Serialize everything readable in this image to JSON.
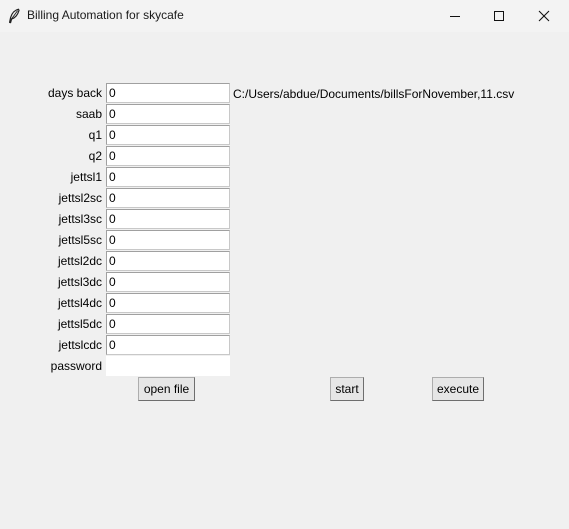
{
  "window": {
    "title": "Billing Automation for skycafe",
    "icon": "feather-icon"
  },
  "form": {
    "rows": [
      {
        "key": "days_back",
        "label": "days back",
        "value": "0"
      },
      {
        "key": "saab",
        "label": "saab",
        "value": "0"
      },
      {
        "key": "q1",
        "label": "q1",
        "value": "0"
      },
      {
        "key": "q2",
        "label": "q2",
        "value": "0"
      },
      {
        "key": "jettsl1",
        "label": "jettsl1",
        "value": "0"
      },
      {
        "key": "jettsl2sc",
        "label": "jettsl2sc",
        "value": "0"
      },
      {
        "key": "jettsl3sc",
        "label": "jettsl3sc",
        "value": "0"
      },
      {
        "key": "jettsl5sc",
        "label": "jettsl5sc",
        "value": "0"
      },
      {
        "key": "jettsl2dc",
        "label": "jettsl2dc",
        "value": "0"
      },
      {
        "key": "jettsl3dc",
        "label": "jettsl3dc",
        "value": "0"
      },
      {
        "key": "jettsl4dc",
        "label": "jettsl4dc",
        "value": "0"
      },
      {
        "key": "jettsl5dc",
        "label": "jettsl5dc",
        "value": "0"
      },
      {
        "key": "jettslcdc",
        "label": "jettslcdc",
        "value": "0"
      },
      {
        "key": "password",
        "label": "password",
        "value": ""
      }
    ],
    "file_path": "C:/Users/abdue/Documents/billsForNovember,11.csv"
  },
  "buttons": {
    "open_file": "open file",
    "start": "start",
    "execute": "execute"
  }
}
